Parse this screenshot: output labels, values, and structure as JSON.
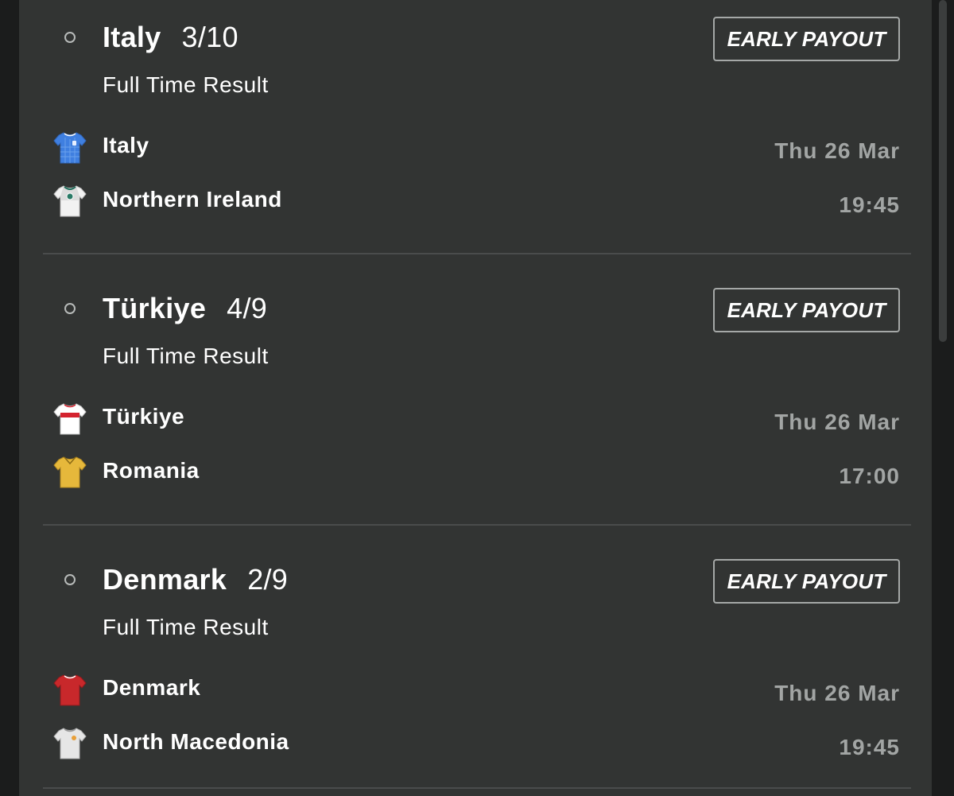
{
  "selections": [
    {
      "team": "Italy",
      "odds": "3/10",
      "market": "Full Time Result",
      "early_payout": "EARLY PAYOUT",
      "home": {
        "name": "Italy",
        "kit_color": "#3f7fe0",
        "kit_icon": "italy-shirt-icon"
      },
      "away": {
        "name": "Northern Ireland",
        "kit_color": "#f2f2f2",
        "kit_icon": "northern-ireland-shirt-icon"
      },
      "date": "Thu 26 Mar",
      "time": "19:45"
    },
    {
      "team": "Türkiye",
      "odds": "4/9",
      "market": "Full Time Result",
      "early_payout": "EARLY PAYOUT",
      "home": {
        "name": "Türkiye",
        "kit_color": "#ffffff",
        "kit_icon": "turkiye-shirt-icon"
      },
      "away": {
        "name": "Romania",
        "kit_color": "#e6b83b",
        "kit_icon": "romania-shirt-icon"
      },
      "date": "Thu 26 Mar",
      "time": "17:00"
    },
    {
      "team": "Denmark",
      "odds": "2/9",
      "market": "Full Time Result",
      "early_payout": "EARLY PAYOUT",
      "home": {
        "name": "Denmark",
        "kit_color": "#c8282b",
        "kit_icon": "denmark-shirt-icon"
      },
      "away": {
        "name": "North Macedonia",
        "kit_color": "#e6e6e6",
        "kit_icon": "north-macedonia-shirt-icon"
      },
      "date": "Thu 26 Mar",
      "time": "19:45"
    }
  ],
  "colors": {
    "panel_bg": "#323433",
    "page_bg": "#1b1c1c",
    "text_primary": "#ffffff",
    "text_secondary": "#a2a5a4",
    "divider": "#4a4c4c",
    "button_border": "#a5a8a7"
  }
}
